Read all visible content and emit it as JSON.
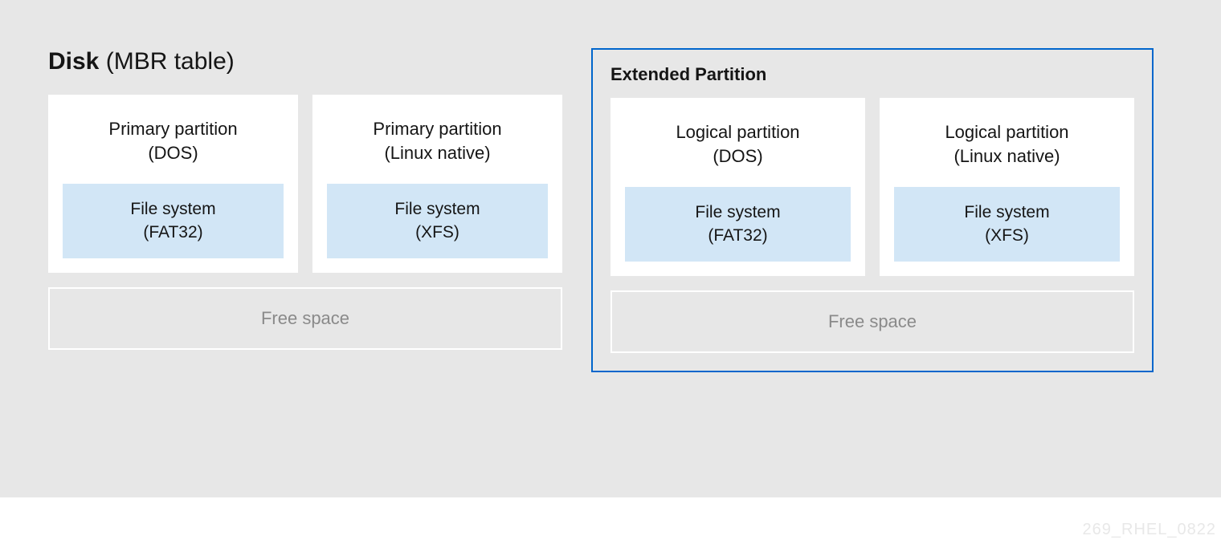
{
  "title_bold": "Disk",
  "title_rest": " (MBR table)",
  "left": {
    "partitions": [
      {
        "name": "Primary partition",
        "type": "(DOS)",
        "fs_label": "File system",
        "fs_type": "(FAT32)"
      },
      {
        "name": "Primary partition",
        "type": "(Linux native)",
        "fs_label": "File system",
        "fs_type": "(XFS)"
      }
    ],
    "free_space": "Free space"
  },
  "right": {
    "heading": "Extended Partition",
    "partitions": [
      {
        "name": "Logical partition",
        "type": "(DOS)",
        "fs_label": "File system",
        "fs_type": "(FAT32)"
      },
      {
        "name": "Logical partition",
        "type": "(Linux native)",
        "fs_label": "File system",
        "fs_type": "(XFS)"
      }
    ],
    "free_space": "Free space"
  },
  "watermark": "269_RHEL_0822"
}
